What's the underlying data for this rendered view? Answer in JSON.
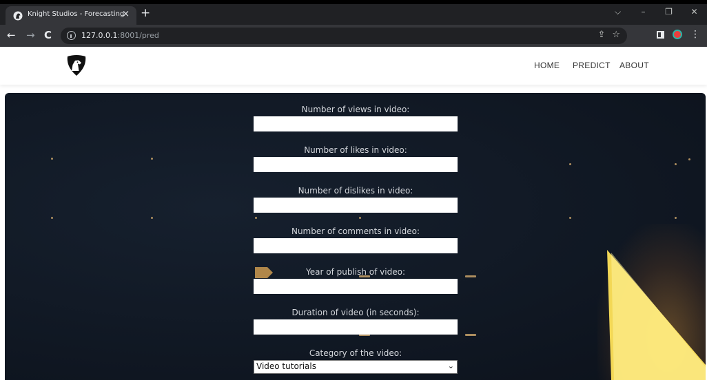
{
  "browser": {
    "tab_title": "Knight Studios - Forecasting",
    "url_host": "127.0.0.1",
    "url_path": ":8001/pred"
  },
  "nav": {
    "home": "HOME",
    "predict": "PREDICT",
    "about": "ABOUT"
  },
  "form": {
    "views_label": "Number of views in video:",
    "likes_label": "Number of likes in video:",
    "dislikes_label": "Number of dislikes in video:",
    "comments_label": "Number of comments in video:",
    "year_label": "Year of publish of video:",
    "duration_label": "Duration of video (in seconds):",
    "category_label": "Category of the video:",
    "category_selected": "Video tutorials"
  },
  "colors": {
    "hero_bg": "#0f1621",
    "beam": "#ffe35a"
  }
}
